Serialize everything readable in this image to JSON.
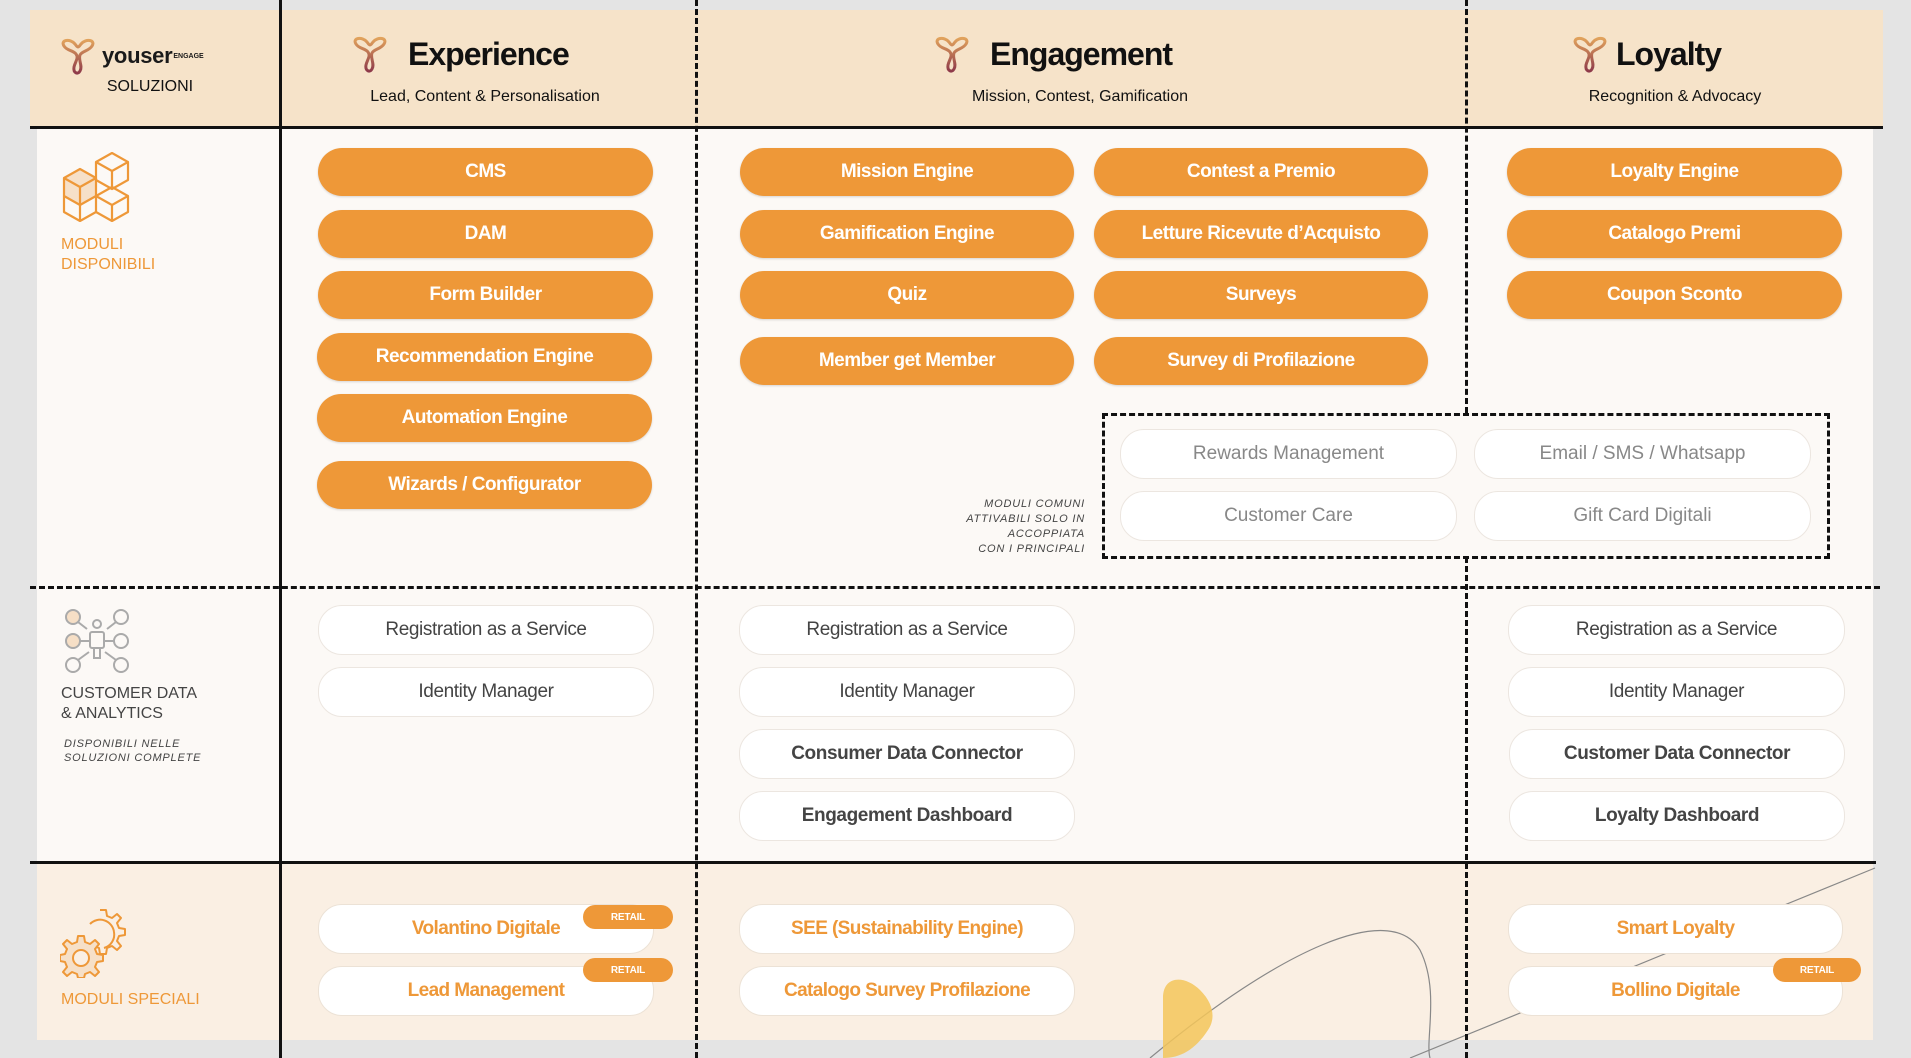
{
  "header": {
    "brand": "youser",
    "brand_suffix": "ENGAGE",
    "subtitle": "SOLUZIONI",
    "columns": [
      {
        "title": "Experience",
        "subtitle": "Lead, Content & Personalisation"
      },
      {
        "title": "Engagement",
        "subtitle": "Mission, Contest, Gamification"
      },
      {
        "title": "Loyalty",
        "subtitle": "Recognition & Advocacy"
      }
    ]
  },
  "rows": {
    "modules": {
      "label_line1": "MODULI",
      "label_line2": "DISPONIBILI",
      "icon": "cubes-icon"
    },
    "customer_data": {
      "label_line1": "CUSTOMER DATA",
      "label_line2": "& ANALYTICS",
      "note_line1": "DISPONIBILI NELLE",
      "note_line2": "SOLUZIONI COMPLETE",
      "icon": "network-person-icon"
    },
    "special": {
      "label": "MODULI  SPECIALI",
      "icon": "gears-icon"
    }
  },
  "modules": {
    "experience": [
      "CMS",
      "DAM",
      "Form Builder",
      "Recommendation Engine",
      "Automation Engine",
      "Wizards / Configurator"
    ],
    "engagement_left": [
      "Mission Engine",
      "Gamification Engine",
      "Quiz",
      "Member get Member"
    ],
    "engagement_right": [
      "Contest a Premio",
      "Letture Ricevute d’Acquisto",
      "Surveys",
      "Survey di Profilazione"
    ],
    "loyalty": [
      "Loyalty Engine",
      "Catalogo Premi",
      "Coupon Sconto"
    ]
  },
  "common_modules": {
    "note": [
      "MODULI COMUNI",
      "ATTIVABILI SOLO IN",
      "ACCOPPIATA",
      "CON I PRINCIPALI"
    ],
    "items": [
      "Rewards Management",
      "Email / SMS / Whatsapp",
      "Customer Care",
      "Gift Card Digitali"
    ]
  },
  "customer_data": {
    "experience": [
      "Registration as a Service",
      "Identity Manager"
    ],
    "engagement": [
      "Registration as a Service",
      "Identity Manager",
      "Consumer Data Connector",
      "Engagement Dashboard"
    ],
    "loyalty": [
      "Registration as a Service",
      "Identity Manager",
      "Customer Data Connector",
      "Loyalty Dashboard"
    ]
  },
  "special_modules": {
    "experience": [
      {
        "label": "Volantino Digitale",
        "tag": "RETAIL"
      },
      {
        "label": "Lead Management",
        "tag": "RETAIL"
      }
    ],
    "engagement": [
      {
        "label": "SEE (Sustainability Engine)"
      },
      {
        "label": "Catalogo Survey Profilazione"
      }
    ],
    "loyalty": [
      {
        "label": "Smart Loyalty"
      },
      {
        "label": "Bollino Digitale",
        "tag": "RETAIL"
      }
    ]
  },
  "colors": {
    "accent": "#ee9838",
    "header_bg": "#f6e3c9",
    "body_bg": "#fcf9f6",
    "special_bg": "#faefe3"
  }
}
